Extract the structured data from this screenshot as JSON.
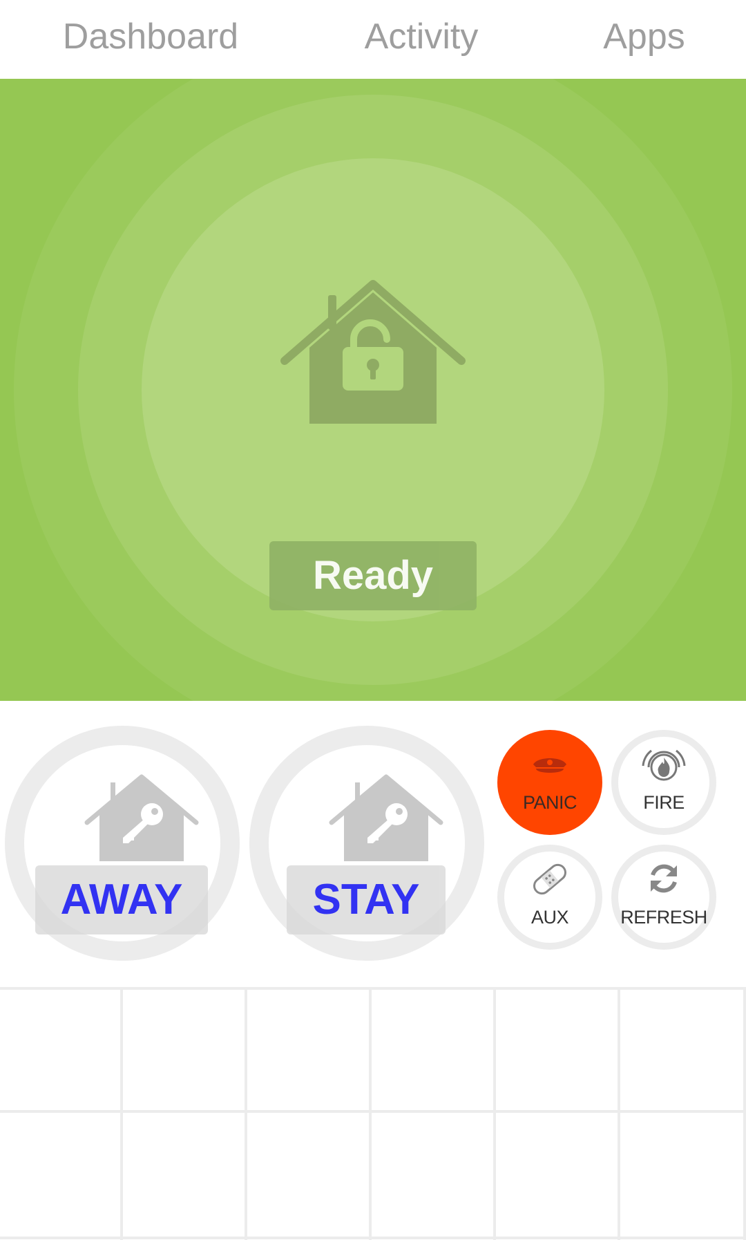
{
  "tabs": [
    {
      "label": "Dashboard"
    },
    {
      "label": "Activity"
    },
    {
      "label": "Apps"
    }
  ],
  "status": {
    "label": "Ready",
    "icon": "house-unlocked-icon",
    "color": "#95c753"
  },
  "arm_buttons": {
    "away": {
      "label": "AWAY",
      "icon": "house-key-icon"
    },
    "stay": {
      "label": "STAY",
      "icon": "house-key-icon"
    }
  },
  "actions": {
    "panic": {
      "label": "PANIC",
      "icon": "police-cap-icon",
      "color": "#ff4500"
    },
    "fire": {
      "label": "FIRE",
      "icon": "fire-alarm-icon"
    },
    "aux": {
      "label": "AUX",
      "icon": "bandage-icon"
    },
    "refresh": {
      "label": "REFRESH",
      "icon": "refresh-icon"
    }
  },
  "grid": {
    "rows": 2,
    "columns": 6
  }
}
